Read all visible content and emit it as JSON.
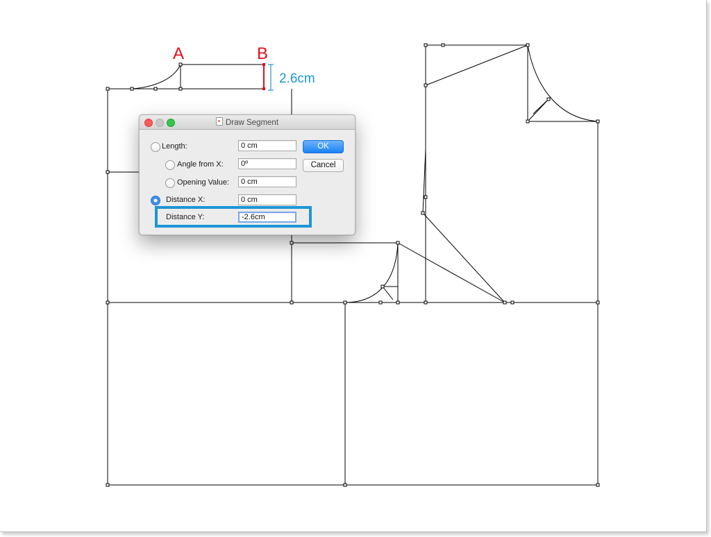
{
  "canvas": {
    "annotations": {
      "point_a_label": "A",
      "point_b_label": "B",
      "measure_label": "2.6cm",
      "colors": {
        "point_labels": "#e0101c",
        "measure": "#1d96d6",
        "highlight": "#1d96d6"
      }
    }
  },
  "dialog": {
    "title": "Draw Segment",
    "title_icon": "document-icon",
    "ok_label": "OK",
    "cancel_label": "Cancel",
    "fields": [
      {
        "label": "Length:",
        "value": "0 cm",
        "selected": false
      },
      {
        "label": "Angle from X:",
        "value": "0º",
        "selected": false
      },
      {
        "label": "Opening Value:",
        "value": "0 cm",
        "selected": false
      },
      {
        "label": "Distance X:",
        "value": "0 cm",
        "selected": true
      },
      {
        "label": "Distance Y:",
        "value": "-2.6cm",
        "selected": false
      }
    ]
  }
}
